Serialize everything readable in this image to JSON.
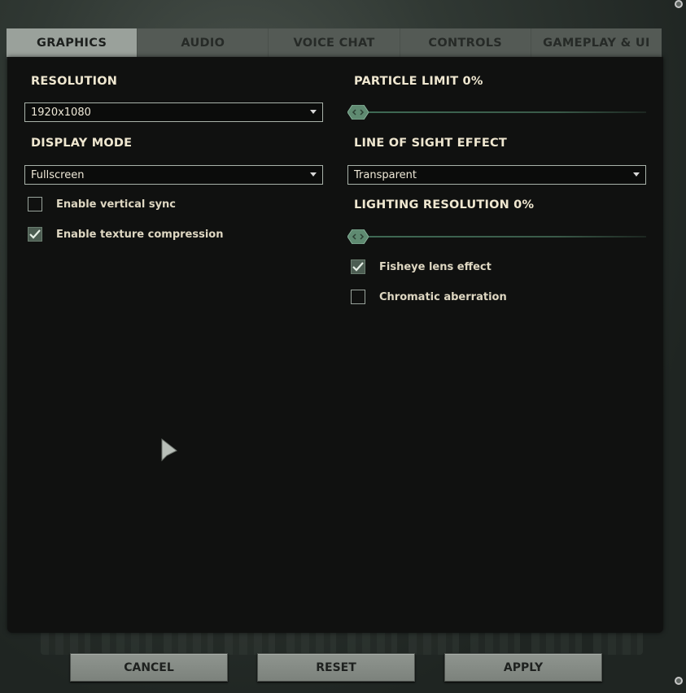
{
  "tabs": [
    {
      "label": "GRAPHICS",
      "active": true
    },
    {
      "label": "AUDIO",
      "active": false
    },
    {
      "label": "VOICE CHAT",
      "active": false
    },
    {
      "label": "CONTROLS",
      "active": false
    },
    {
      "label": "GAMEPLAY & UI",
      "active": false
    }
  ],
  "left": {
    "resolution": {
      "heading": "RESOLUTION",
      "value": "1920x1080"
    },
    "display_mode": {
      "heading": "DISPLAY MODE",
      "value": "Fullscreen"
    },
    "vsync": {
      "label": "Enable vertical sync",
      "checked": false
    },
    "texture_compression": {
      "label": "Enable texture compression",
      "checked": true
    }
  },
  "right": {
    "particle_limit": {
      "heading": "PARTICLE LIMIT 0%",
      "value_percent": 0
    },
    "line_of_sight": {
      "heading": "LINE OF SIGHT EFFECT",
      "value": "Transparent"
    },
    "lighting_resolution": {
      "heading": "LIGHTING RESOLUTION 0%",
      "value_percent": 0
    },
    "fisheye": {
      "label": "Fisheye lens effect",
      "checked": true
    },
    "chromatic": {
      "label": "Chromatic aberration",
      "checked": false
    }
  },
  "buttons": {
    "cancel": "CANCEL",
    "reset": "RESET",
    "apply": "APPLY"
  },
  "colors": {
    "accent": "#3f6b55",
    "tab_active": "#9aa19b",
    "panel": "#101110"
  }
}
